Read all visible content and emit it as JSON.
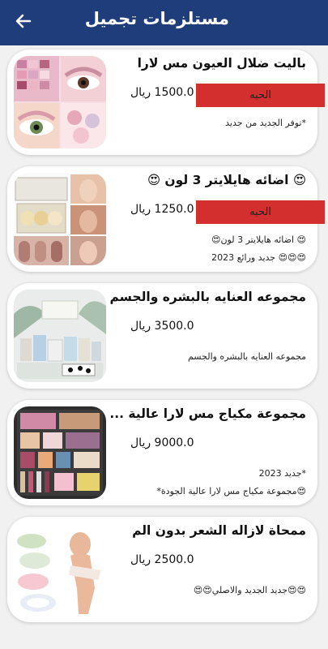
{
  "appbar": {
    "title": "مستلزمات تجميل"
  },
  "status_label": "الحبه",
  "products": [
    {
      "name": "باليت ضلال العيون مس لارا",
      "price": "1500.0 ريال",
      "desc1": "*توفر الجديد من جديد",
      "desc2": "",
      "has_status": true
    },
    {
      "name": "😍 اضائه هايلايتر 3 لون 😍",
      "price": "1250.0 ريال",
      "desc1": "😍 اضائه هايلايتر 3 لون😍",
      "desc2": "😍😍😍 جديد ورائع 2023",
      "has_status": true
    },
    {
      "name": "مجموعه العنايه بالبشره والجسم",
      "price": "3500.0 ريال",
      "desc1": "مجموعه العنايه بالبشره والجسم",
      "desc2": "",
      "has_status": false
    },
    {
      "name": "مجموعة مكياج مس لارا  عالية ...",
      "price": "9000.0 ريال",
      "desc1": "*جديد  2023",
      "desc2": "😍مجموعة مكياج مس لارا  عالية الجودة*",
      "has_status": false
    },
    {
      "name": "ممحاة لازاله الشعر بدون الم",
      "price": "2500.0 ريال",
      "desc1": "😍😍جديد الجديد والاصلي😍😍",
      "desc2": "",
      "has_status": false
    }
  ]
}
